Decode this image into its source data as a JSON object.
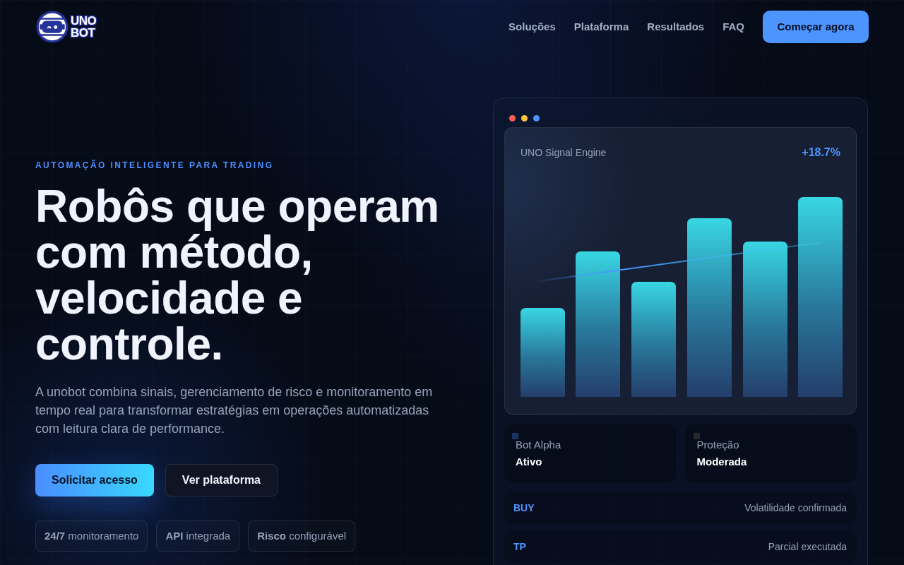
{
  "nav": {
    "logo": {
      "lines": [
        "UNO",
        "BOT"
      ]
    },
    "links": [
      {
        "label": "Soluções"
      },
      {
        "label": "Plataforma"
      },
      {
        "label": "Resultados"
      },
      {
        "label": "FAQ"
      }
    ],
    "cta": "Começar agora"
  },
  "hero": {
    "eyebrow": "AUTOMAÇÃO INTELIGENTE PARA TRADING",
    "title": "Robôs que operam com método, velocidade e controle.",
    "description": "A unobot combina sinais, gerenciamento de risco e monitoramento em tempo real para transformar estratégias em operações automatizadas com leitura clara de performance.",
    "buttons": [
      {
        "label": "Solicitar acesso",
        "kind": "primary"
      },
      {
        "label": "Ver plataforma",
        "kind": "secondary"
      }
    ],
    "highlights": [
      "**24/7** monitoramento",
      "**API** integrada",
      "**Risco** configurável"
    ]
  },
  "dashboard": {
    "window_dots": [
      {
        "color": "#ff5f57"
      },
      {
        "color": "#ffc53d"
      },
      {
        "color": "#4d94ff"
      }
    ],
    "chart_card": {
      "title": "UNO Signal Engine",
      "change": "+18.7%"
    },
    "status_cards": [
      {
        "label": "Bot Alpha",
        "value": "Ativo",
        "color": "#1b3261"
      },
      {
        "label": "Proteção",
        "value": "Moderada",
        "color": "#262a30"
      }
    ],
    "signals": [
      {
        "tag": "BUY",
        "text": "Volatilidade confirmada"
      },
      {
        "tag": "TP",
        "text": "Parcial executada"
      }
    ]
  }
}
